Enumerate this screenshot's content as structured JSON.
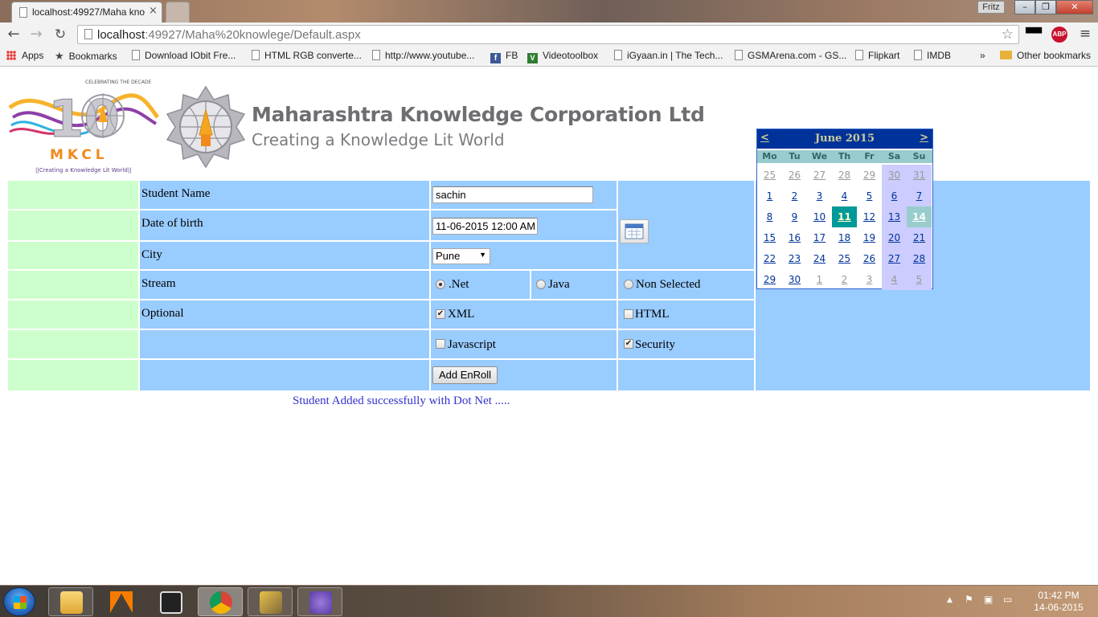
{
  "browser": {
    "tab_title": "localhost:49927/Maha kno",
    "tab_close": "×",
    "user": "Fritz",
    "url_host": "localhost",
    "url_rest": ":49927/Maha%20knowlege/Default.aspx"
  },
  "bookmarks": {
    "items": [
      "Apps",
      "Bookmarks",
      "Download IObit Fre...",
      "HTML RGB converte...",
      "http://www.youtube...",
      "FB",
      "Videotoolbox",
      "iGyaan.in | The Tech...",
      "GSMArena.com - GS...",
      "Flipkart",
      "IMDB"
    ],
    "overflow": "»",
    "other": "Other bookmarks"
  },
  "header": {
    "logo_text": "MKCL",
    "logo_tagline": "||Creating a Knowledge Lit World||",
    "corp_name": "Maharashtra Knowledge Corporation Ltd",
    "corp_tagline": "Creating a Knowledge Lit World"
  },
  "form": {
    "student_name_label": "Student Name",
    "student_name_value": "sachin",
    "dob_label": "Date of birth",
    "dob_value": "11-06-2015 12:00 AM",
    "city_label": "City",
    "city_value": "Pune",
    "stream_label": "Stream",
    "stream_options": [
      ".Net",
      "Java",
      "Non Selected"
    ],
    "stream_selected": ".Net",
    "optional_label": "Optional",
    "optional_xml": "XML",
    "optional_html": "HTML",
    "optional_javascript": "Javascript",
    "optional_security": "Security",
    "checked": {
      "XML": true,
      "HTML": false,
      "Javascript": false,
      "Security": true
    },
    "submit_label": "Add EnRoll",
    "status_message": "Student Added successfully with Dot Net ....."
  },
  "calendar": {
    "prev": "<",
    "next": ">",
    "title": "June 2015",
    "weekdays": [
      "Mo",
      "Tu",
      "We",
      "Th",
      "Fr",
      "Sa",
      "Su"
    ],
    "weeks": [
      [
        "25",
        "26",
        "27",
        "28",
        "29",
        "30",
        "31"
      ],
      [
        "1",
        "2",
        "3",
        "4",
        "5",
        "6",
        "7"
      ],
      [
        "8",
        "9",
        "10",
        "11",
        "12",
        "13",
        "14"
      ],
      [
        "15",
        "16",
        "17",
        "18",
        "19",
        "20",
        "21"
      ],
      [
        "22",
        "23",
        "24",
        "25",
        "26",
        "27",
        "28"
      ],
      [
        "29",
        "30",
        "1",
        "2",
        "3",
        "4",
        "5"
      ]
    ],
    "selected_day": "11",
    "today": "14",
    "colors": {
      "header_bg": "#003399",
      "dow_bg": "#99cccc",
      "selected_bg": "#009999",
      "weekend_bg": "#ccccff",
      "day_text": "#003399"
    }
  },
  "taskbar": {
    "time": "01:42 PM",
    "date": "14-06-2015"
  },
  "colors": {
    "form_blue": "#99ccff",
    "form_green": "#ccffcc",
    "status_text": "#3333cc"
  }
}
